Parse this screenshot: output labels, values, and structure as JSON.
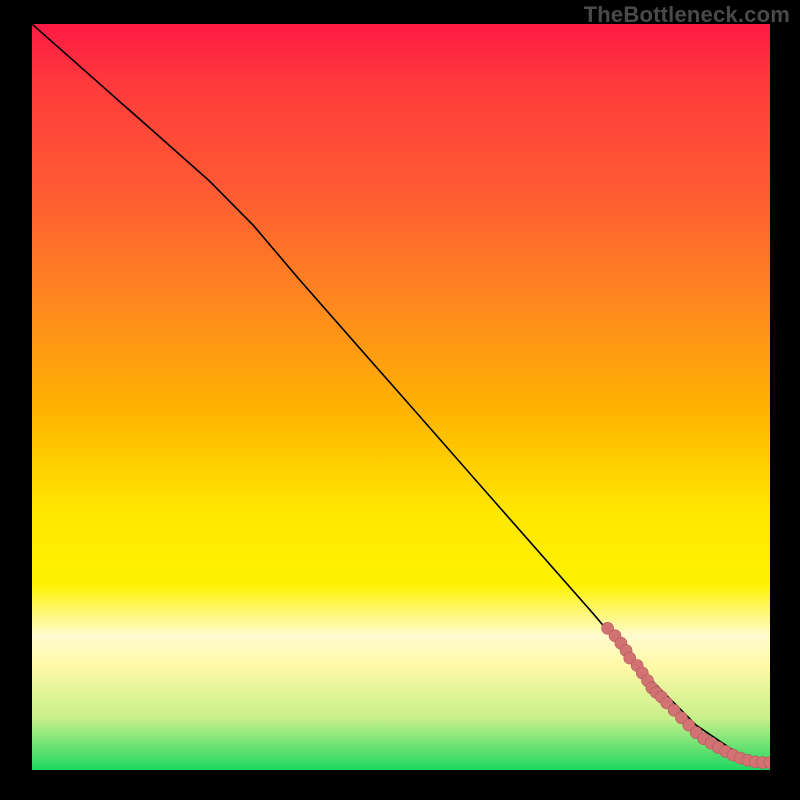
{
  "watermark": "TheBottleneck.com",
  "chart_data": {
    "type": "line",
    "title": "",
    "xlabel": "",
    "ylabel": "",
    "xlim": [
      0,
      100
    ],
    "ylim": [
      0,
      100
    ],
    "grid": false,
    "legend": false,
    "gradient_axis": "y",
    "gradient_stops": [
      {
        "pos": 0,
        "color": "#1ed760"
      },
      {
        "pos": 7,
        "color": "#c8f08a"
      },
      {
        "pos": 14,
        "color": "#fff9a8"
      },
      {
        "pos": 18,
        "color": "#fffbcf"
      },
      {
        "pos": 25,
        "color": "#fff200"
      },
      {
        "pos": 35,
        "color": "#ffe600"
      },
      {
        "pos": 48,
        "color": "#ffb400"
      },
      {
        "pos": 62,
        "color": "#ff8a1e"
      },
      {
        "pos": 78,
        "color": "#ff5a33"
      },
      {
        "pos": 92,
        "color": "#ff3a3c"
      },
      {
        "pos": 100,
        "color": "#ff1a44"
      }
    ],
    "series": [
      {
        "name": "curve",
        "kind": "line",
        "x": [
          0,
          8,
          16,
          24,
          30,
          36,
          44,
          52,
          60,
          68,
          76,
          82,
          86,
          90,
          93,
          96,
          98,
          100
        ],
        "y": [
          100,
          93,
          86,
          79,
          73,
          66,
          57,
          48,
          39,
          30,
          21,
          14,
          10,
          6,
          4,
          2,
          1,
          1
        ]
      },
      {
        "name": "dots",
        "kind": "scatter",
        "x": [
          78,
          79,
          79.8,
          80.5,
          81,
          82,
          82.7,
          83.4,
          84,
          84.6,
          85.3,
          86,
          87,
          88,
          89,
          90,
          91,
          92,
          93,
          94,
          95,
          96,
          97,
          98,
          99,
          100
        ],
        "y": [
          19,
          18,
          17,
          16,
          15,
          14,
          13,
          12,
          11,
          10.4,
          9.8,
          9,
          8,
          7,
          6,
          5,
          4.2,
          3.6,
          3,
          2.5,
          2,
          1.6,
          1.3,
          1.1,
          1,
          1
        ]
      }
    ]
  }
}
